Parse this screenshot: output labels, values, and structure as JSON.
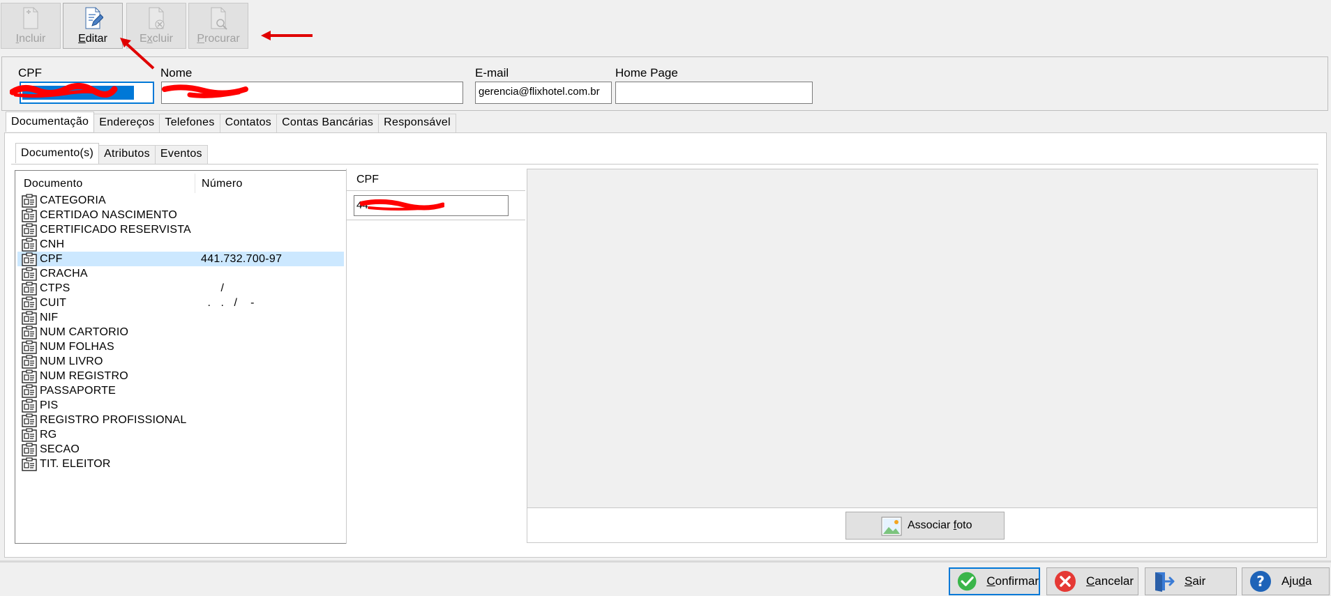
{
  "toolbar": {
    "buttons": [
      {
        "label": "Incluir",
        "enabled": false,
        "icon": "add-document-icon"
      },
      {
        "label": "Editar",
        "enabled": true,
        "icon": "edit-document-icon"
      },
      {
        "label": "Excluir",
        "enabled": false,
        "icon": "delete-document-icon"
      },
      {
        "label": "Procurar",
        "enabled": false,
        "icon": "search-document-icon"
      }
    ]
  },
  "header": {
    "cpf_label": "CPF",
    "nome_label": "Nome",
    "email_label": "E-mail",
    "email_value": "gerencia@flixhotel.com.br",
    "homepage_label": "Home Page",
    "homepage_value": ""
  },
  "tabs": [
    "Documentação",
    "Endereços",
    "Telefones",
    "Contatos",
    "Contas Bancárias",
    "Responsável"
  ],
  "subtabs": [
    "Documento(s)",
    "Atributos",
    "Eventos"
  ],
  "doclist": {
    "col_documento": "Documento",
    "col_numero": "Número",
    "rows": [
      {
        "name": "CATEGORIA",
        "num": ""
      },
      {
        "name": "CERTIDAO NASCIMENTO",
        "num": ""
      },
      {
        "name": "CERTIFICADO RESERVISTA",
        "num": ""
      },
      {
        "name": "CNH",
        "num": ""
      },
      {
        "name": "CPF",
        "num": "441.732.700-97"
      },
      {
        "name": "CRACHA",
        "num": ""
      },
      {
        "name": "CTPS",
        "num": "      /"
      },
      {
        "name": "CUIT",
        "num": "  .   .   /    -"
      },
      {
        "name": "NIF",
        "num": ""
      },
      {
        "name": "NUM CARTORIO",
        "num": ""
      },
      {
        "name": "NUM FOLHAS",
        "num": ""
      },
      {
        "name": "NUM LIVRO",
        "num": ""
      },
      {
        "name": "NUM REGISTRO",
        "num": ""
      },
      {
        "name": "PASSAPORTE",
        "num": ""
      },
      {
        "name": "PIS",
        "num": ""
      },
      {
        "name": "REGISTRO PROFISSIONAL",
        "num": ""
      },
      {
        "name": "RG",
        "num": ""
      },
      {
        "name": "SECAO",
        "num": ""
      },
      {
        "name": "TIT. ELEITOR",
        "num": ""
      }
    ]
  },
  "detail": {
    "header": "CPF",
    "value_prefix": "44"
  },
  "photo": {
    "assoc_button": "Associar foto"
  },
  "footer": {
    "confirmar": "Confirmar",
    "cancelar": "Cancelar",
    "sair": "Sair",
    "ajuda": "Ajuda"
  }
}
